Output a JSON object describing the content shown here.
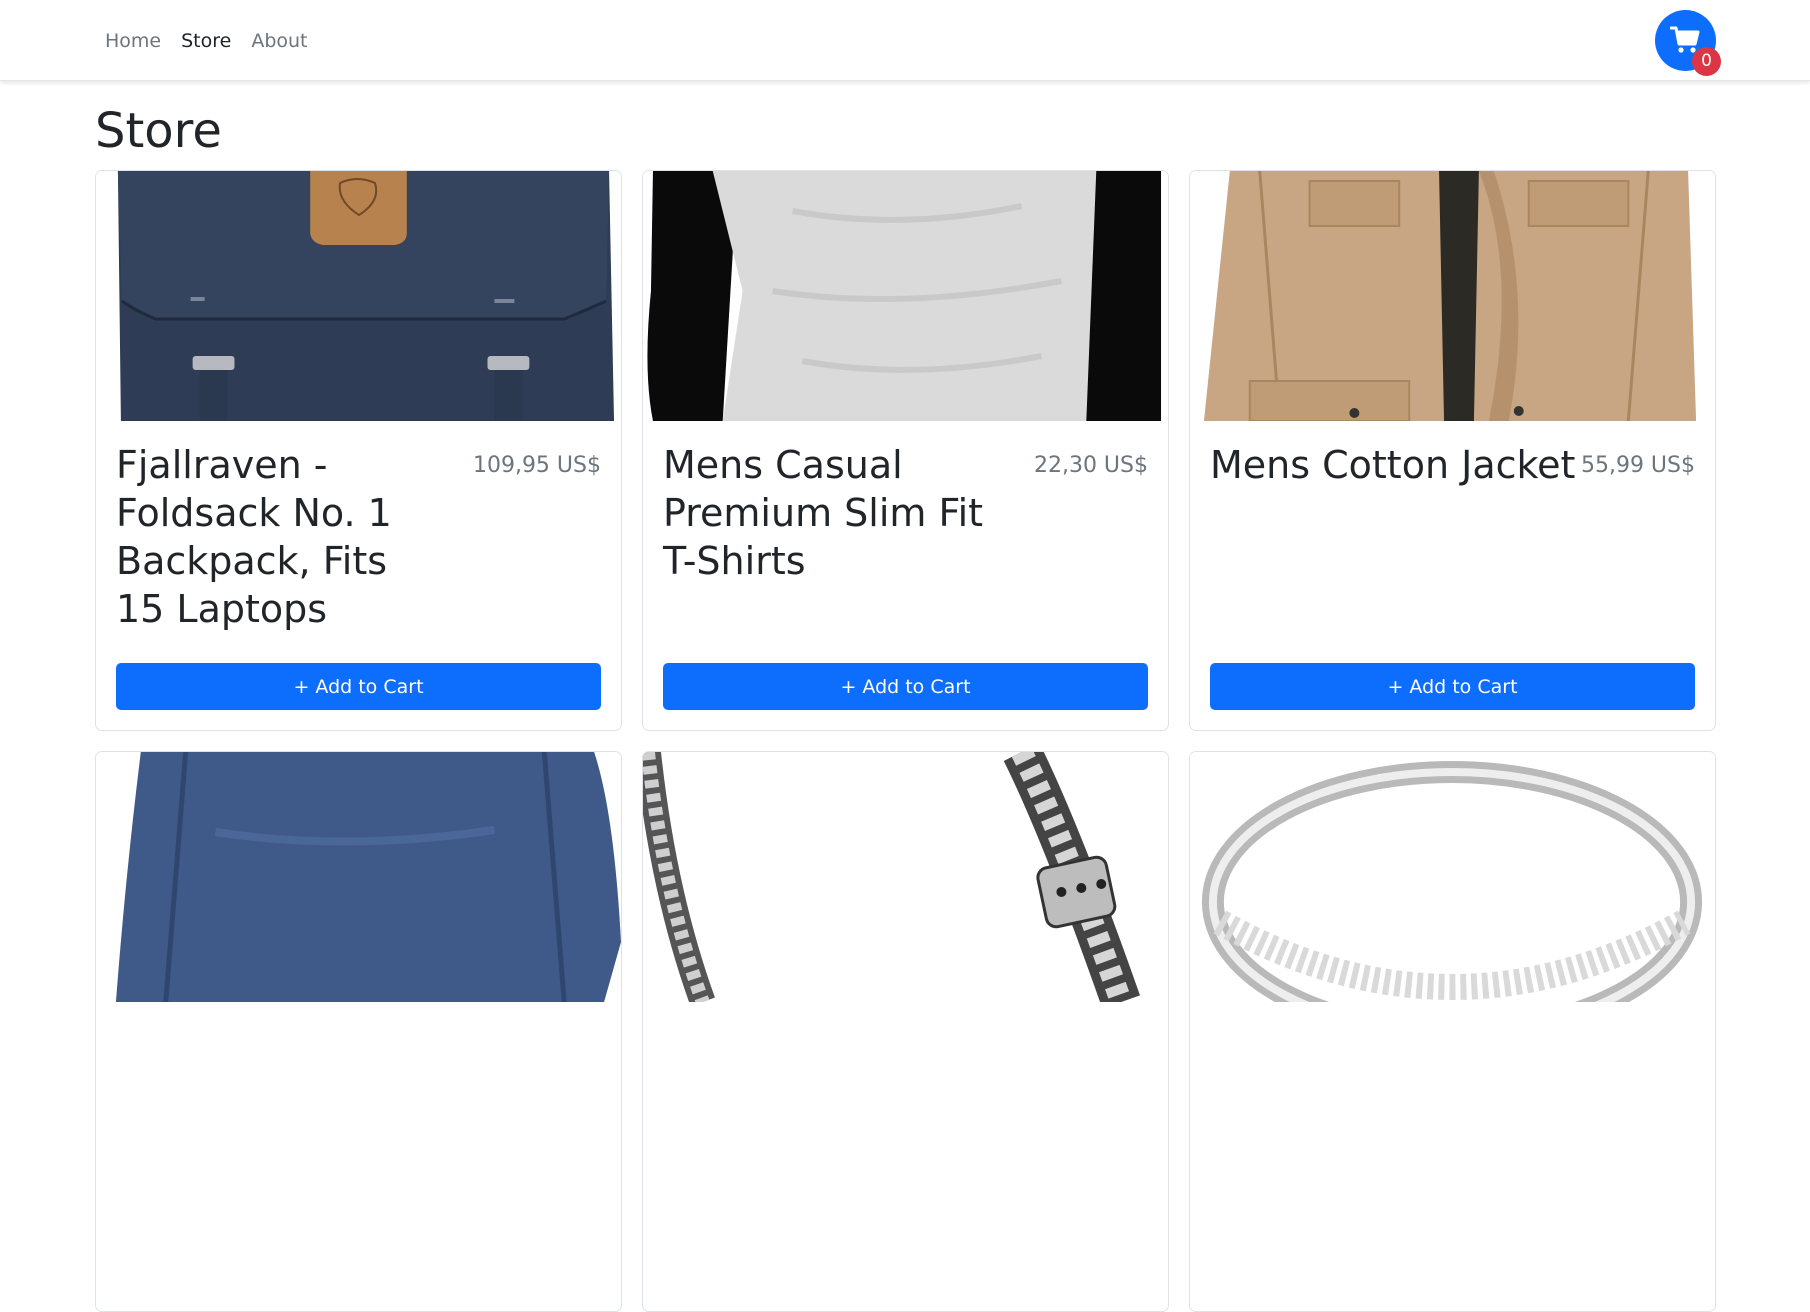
{
  "nav": {
    "links": [
      {
        "label": "Home",
        "active": false
      },
      {
        "label": "Store",
        "active": true
      },
      {
        "label": "About",
        "active": false
      }
    ],
    "cart_count": "0",
    "accent": "#0d6efd",
    "badge_color": "#dc3545"
  },
  "page": {
    "title": "Store"
  },
  "products": [
    {
      "title": "Fjallraven - Foldsack No. 1 Backpack, Fits 15 Laptops",
      "price": "109,95 US$",
      "button": "+ Add to Cart",
      "image": "backpack-image"
    },
    {
      "title": "Mens Casual Premium Slim Fit T-Shirts",
      "price": "22,30 US$",
      "button": "+ Add to Cart",
      "image": "tshirt-image"
    },
    {
      "title": "Mens Cotton Jacket",
      "price": "55,99 US$",
      "button": "+ Add to Cart",
      "image": "jacket-image"
    },
    {
      "title": "",
      "price": "",
      "button": "",
      "image": "longsleeve-shirt-image"
    },
    {
      "title": "",
      "price": "",
      "button": "",
      "image": "bracelet-image"
    },
    {
      "title": "",
      "price": "",
      "button": "",
      "image": "ring-image"
    }
  ]
}
